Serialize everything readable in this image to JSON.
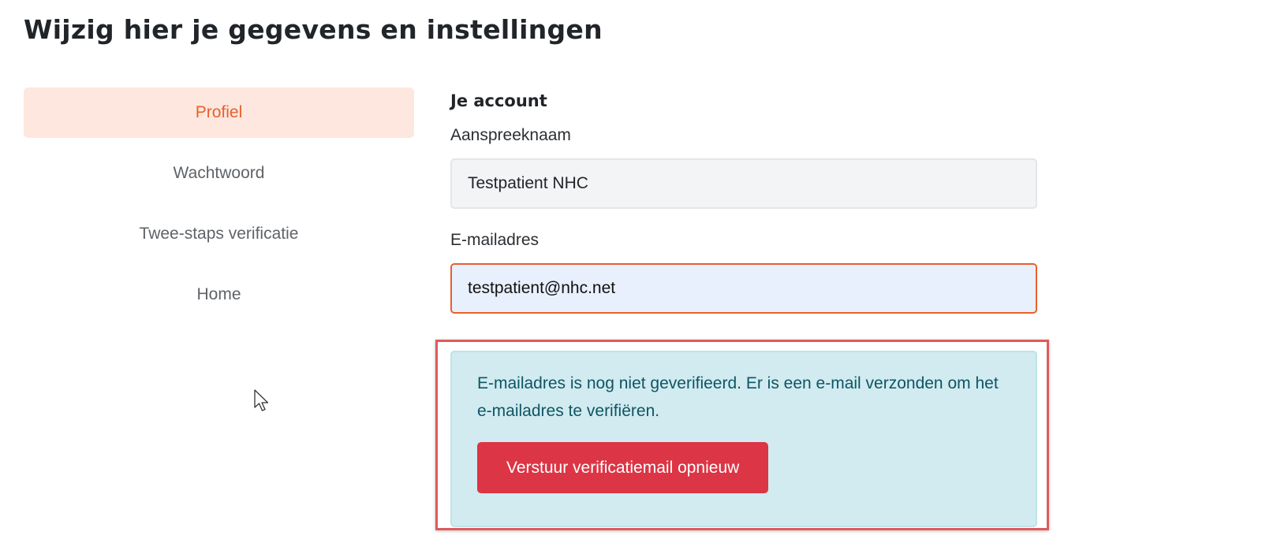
{
  "page": {
    "title": "Wijzig hier je gegevens en instellingen"
  },
  "sidebar": {
    "items": [
      {
        "label": "Profiel",
        "active": true
      },
      {
        "label": "Wachtwoord",
        "active": false
      },
      {
        "label": "Twee-staps verificatie",
        "active": false
      },
      {
        "label": "Home",
        "active": false
      }
    ]
  },
  "account": {
    "section_title": "Je account",
    "name_label": "Aanspreeknaam",
    "name_value": "Testpatient NHC",
    "email_label": "E-mailadres",
    "email_value": "testpatient@nhc.net"
  },
  "verification_alert": {
    "message": "E-mailadres is nog niet geverifieerd. Er is een e-mail verzonden om het e-mailadres te verifiëren.",
    "button_label": "Verstuur verificatiemail opnieuw"
  },
  "colors": {
    "accent": "#e8602c",
    "active_nav_bg": "#fde7de",
    "alert_bg": "#d1ebf0",
    "alert_text": "#0f5563",
    "danger": "#dc3545",
    "highlight_frame": "#e05a5a"
  },
  "icons": {
    "cursor": "mouse-pointer-icon"
  }
}
